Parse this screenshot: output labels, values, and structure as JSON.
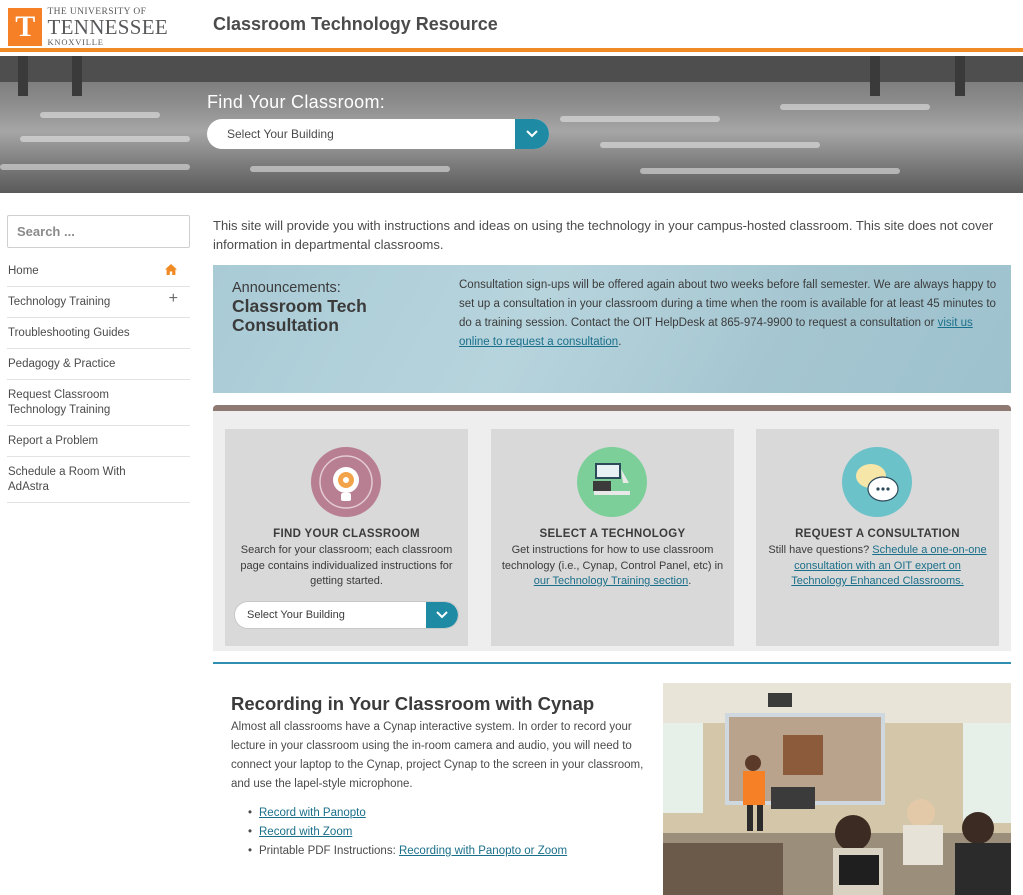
{
  "header": {
    "logo_line1": "THE UNIVERSITY OF",
    "logo_line2": "TENNESSEE",
    "logo_line3": "KNOXVILLE",
    "logo_letter": "T",
    "site_title": "Classroom Technology Resource",
    "accent_color": "#f08a24"
  },
  "hero": {
    "label": "Find Your Classroom:",
    "select_value": "Select Your Building"
  },
  "sidebar": {
    "search_placeholder": "Search ...",
    "items": [
      {
        "label": "Home",
        "icon": "home-icon"
      },
      {
        "label": "Technology Training",
        "icon": "plus-icon"
      },
      {
        "label": "Troubleshooting Guides"
      },
      {
        "label": "Pedagogy & Practice"
      },
      {
        "label": "Request Classroom Technology Training"
      },
      {
        "label": "Report a Problem"
      },
      {
        "label": "Schedule a Room With AdAstra"
      }
    ]
  },
  "intro": "This site will provide you with instructions and ideas on using the technology in your campus-hosted classroom. This site does not cover information in departmental classrooms.",
  "announcement": {
    "label": "Announcements:",
    "title": "Classroom Tech Consultation",
    "body": "Consultation sign-ups will be offered again about two weeks before fall semester. We are always happy to set up a consultation in your classroom during a time when the room is available for at least 45 minutes to do a training session. Contact the OIT HelpDesk at 865-974-9900 to request a consultation or ",
    "link": "visit us online to request a consultation",
    "tail": "."
  },
  "cards": [
    {
      "title": "FIND YOUR CLASSROOM",
      "text": "Search for your classroom; each classroom page contains individualized instructions for getting started.",
      "select_value": "Select Your Building",
      "icon": "lightbulb-gear-icon",
      "icon_color": "#b87e92"
    },
    {
      "title": "SELECT A TECHNOLOGY",
      "text": "Get instructions for how to use classroom technology (i.e., Cynap, Control Panel, etc) in ",
      "link": "our Technology Training section",
      "tail": ".",
      "icon": "classroom-tech-icon",
      "icon_color": "#7ccf98"
    },
    {
      "title": "REQUEST A CONSULTATION",
      "text": "Still have questions? ",
      "link": "Schedule a one-on-one consultation with an OIT expert on Technology Enhanced Classrooms.",
      "icon": "chat-bubbles-icon",
      "icon_color": "#6cc2c9"
    }
  ],
  "cynap": {
    "title": "Recording in Your Classroom with Cynap",
    "text": "Almost all classrooms have a Cynap interactive system. In order to record your lecture in your classroom using the in-room camera and audio, you will need to connect your laptop to the Cynap, project Cynap to the screen in your classroom, and use the lapel-style microphone.",
    "links": [
      {
        "label": "Record with Panopto"
      },
      {
        "label": "Record with Zoom"
      },
      {
        "prefix": "Printable PDF Instructions: ",
        "label": "Recording with Panopto or Zoom"
      }
    ]
  }
}
